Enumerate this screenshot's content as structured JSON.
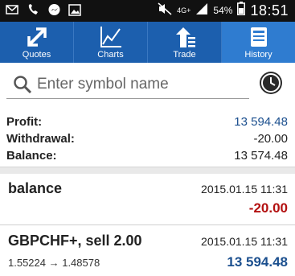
{
  "status": {
    "network": "4G+",
    "battery": "54%",
    "time": "18:51"
  },
  "tabs": [
    {
      "label": "Quotes",
      "icon": "quotes-arrows-icon"
    },
    {
      "label": "Charts",
      "icon": "chart-line-icon"
    },
    {
      "label": "Trade",
      "icon": "trade-icon"
    },
    {
      "label": "History",
      "icon": "history-book-icon",
      "active": true
    }
  ],
  "search": {
    "placeholder": "Enter symbol name"
  },
  "summary": {
    "profit_label": "Profit:",
    "profit_value": "13 594.48",
    "withdrawal_label": "Withdrawal:",
    "withdrawal_value": "-20.00",
    "balance_label": "Balance:",
    "balance_value": "13 574.48"
  },
  "entries": [
    {
      "name": "balance",
      "date": "2015.01.15 11:31",
      "amount": "-20.00"
    },
    {
      "name": "GBPCHF+, sell 2.00",
      "date": "2015.01.15 11:31",
      "prices": "1.55224 → 1.48578",
      "amount": "13 594.48"
    }
  ],
  "colors": {
    "tabbar": "#1c5fae",
    "tab_active": "#2f7cd0",
    "positive": "#1b4f8e",
    "negative": "#b31010"
  }
}
